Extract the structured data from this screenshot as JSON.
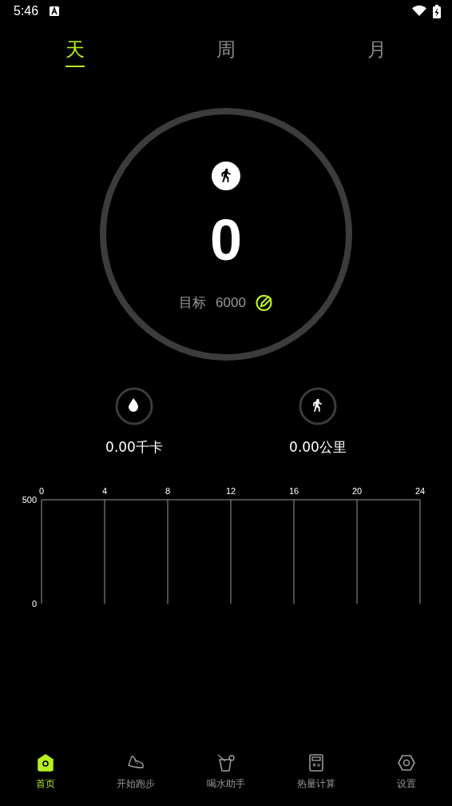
{
  "status_bar": {
    "time": "5:46"
  },
  "tabs": [
    {
      "label": "天",
      "selected": true
    },
    {
      "label": "周",
      "selected": false
    },
    {
      "label": "月",
      "selected": false
    }
  ],
  "steps": {
    "value": "0",
    "goal_label": "目标",
    "goal": "6000"
  },
  "stats": [
    {
      "kind": "calories",
      "value": "0.00千卡"
    },
    {
      "kind": "distance",
      "value": "0.00公里"
    }
  ],
  "chart": {
    "chart_data": {
      "type": "bar",
      "xlim": [
        0,
        24
      ],
      "ylim": [
        0,
        500
      ],
      "xticks": [
        0,
        4,
        8,
        12,
        16,
        20,
        24
      ],
      "yticks": [
        0,
        500
      ],
      "grid": true
    }
  },
  "nav": {
    "items": [
      {
        "kind": "home",
        "label": "首页",
        "selected": true
      },
      {
        "kind": "run",
        "label": "开始跑步",
        "selected": false
      },
      {
        "kind": "water",
        "label": "喝水助手",
        "selected": false
      },
      {
        "kind": "calc",
        "label": "热量计算",
        "selected": false
      },
      {
        "kind": "settings",
        "label": "设置",
        "selected": false
      }
    ]
  }
}
